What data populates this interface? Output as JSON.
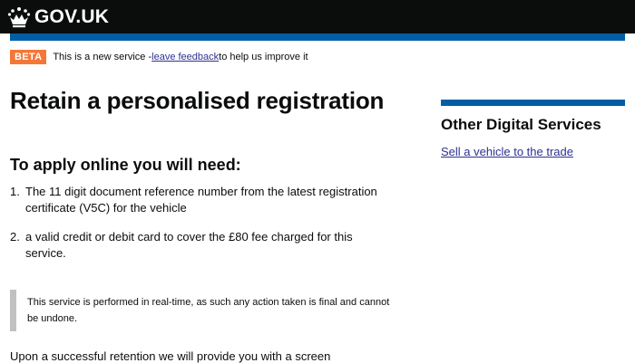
{
  "header": {
    "logo_text": "GOV.UK",
    "crown_icon": "crown-icon"
  },
  "colors": {
    "header_bg": "#0b0c0c",
    "brand_blue": "#005ea5",
    "beta_orange": "#f47738",
    "link": "#2e3191"
  },
  "phase_banner": {
    "tag": "BETA",
    "text_before": "This is a new service - ",
    "link_text": "leave feedback",
    "text_after": " to help us improve it"
  },
  "main": {
    "title": "Retain a personalised registration",
    "apply_heading": "To apply online you will need:",
    "requirements": [
      {
        "num": "1.",
        "text": "The 11 digit document reference number from the latest registration certificate (V5C) for the vehicle"
      },
      {
        "num": "2.",
        "text": "a valid credit or debit card to cover the £80 fee charged for this service."
      }
    ],
    "inset_text": "This service is performed in real-time, as such any action taken is final and cannot be undone.",
    "bottom_text": "Upon a successful retention we will provide you with a screen"
  },
  "sidebar": {
    "title": "Other Digital Services",
    "link": "Sell a vehicle to the trade"
  }
}
